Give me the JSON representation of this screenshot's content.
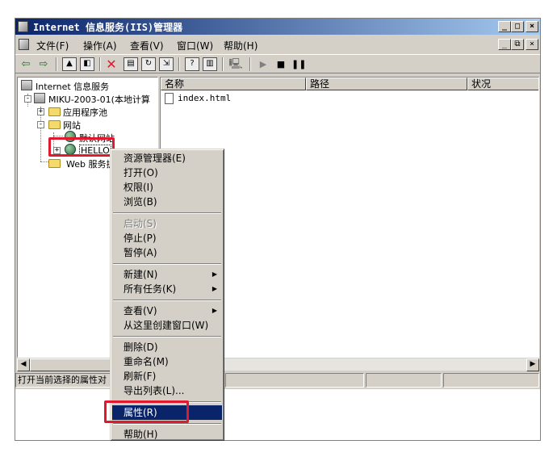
{
  "window": {
    "title": "Internet 信息服务(IIS)管理器",
    "caption_buttons": [
      "_",
      "□",
      "×"
    ],
    "child_caption_buttons": [
      "_",
      "⧉",
      "×"
    ]
  },
  "menubar": {
    "items": [
      {
        "label": "文件(F)"
      },
      {
        "label": "操作(A)"
      },
      {
        "label": "查看(V)"
      },
      {
        "label": "窗口(W)"
      },
      {
        "label": "帮助(H)"
      }
    ]
  },
  "toolbar": {
    "icons": [
      "back-arrow-icon",
      "forward-arrow-icon",
      "up-level-icon",
      "show-hide-tree-icon",
      "delete-icon",
      "properties-icon",
      "refresh-icon",
      "export-list-icon",
      "help-icon",
      "show-hide-action-pane-icon",
      "computer-icon",
      "start-icon",
      "stop-icon",
      "pause-icon"
    ],
    "delete_color": "#e0192e"
  },
  "tree": {
    "root": "Internet 信息服务",
    "computer": "MIKU-2003-01(本地计算",
    "app_pools": "应用程序池",
    "websites": "网站",
    "default_site": "默认网站",
    "hello_site": "HELLO",
    "web_ext": "Web 服务扩"
  },
  "list": {
    "columns": [
      "名称",
      "路径",
      "状况"
    ],
    "rows": [
      {
        "name": "index.html"
      }
    ]
  },
  "status": {
    "text": "打开当前选择的属性对"
  },
  "context_menu": {
    "groups": [
      [
        {
          "label": "资源管理器(E)",
          "enabled": true
        },
        {
          "label": "打开(O)",
          "enabled": true
        },
        {
          "label": "权限(I)",
          "enabled": true
        },
        {
          "label": "浏览(B)",
          "enabled": true
        }
      ],
      [
        {
          "label": "启动(S)",
          "enabled": false
        },
        {
          "label": "停止(P)",
          "enabled": true
        },
        {
          "label": "暂停(A)",
          "enabled": true
        }
      ],
      [
        {
          "label": "新建(N)",
          "enabled": true,
          "submenu": true
        },
        {
          "label": "所有任务(K)",
          "enabled": true,
          "submenu": true
        }
      ],
      [
        {
          "label": "查看(V)",
          "enabled": true,
          "submenu": true
        },
        {
          "label": "从这里创建窗口(W)",
          "enabled": true
        }
      ],
      [
        {
          "label": "删除(D)",
          "enabled": true
        },
        {
          "label": "重命名(M)",
          "enabled": true
        },
        {
          "label": "刷新(F)",
          "enabled": true
        },
        {
          "label": "导出列表(L)...",
          "enabled": true
        }
      ],
      [
        {
          "label": "属性(R)",
          "enabled": true,
          "selected": true
        }
      ],
      [
        {
          "label": "帮助(H)",
          "enabled": true
        }
      ]
    ]
  },
  "highlight_color": "#e0192e",
  "selection_color": "#0a246a"
}
